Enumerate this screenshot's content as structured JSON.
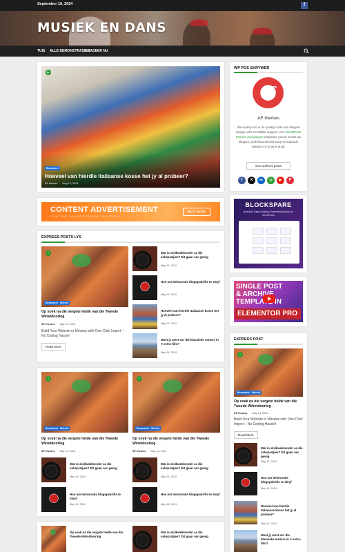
{
  "topbar": {
    "date": "September 16, 2024",
    "social_icon": "facebook-icon"
  },
  "site": {
    "title": "MUSIEK EN DANS"
  },
  "nav": {
    "items": [
      "TUIS",
      "ALLE DEMONSTRASIES",
      "GRADEER NU"
    ],
    "search_icon": "search-icon"
  },
  "hero": {
    "category": "Beoordeel",
    "title": "Hoeveel van hierdie Italiaanse kosse het jy al probeer?",
    "author": "AF themes",
    "date": "May 14, 2024"
  },
  "ad": {
    "title": "CONTENT ADVERTISEMENT",
    "subtitle": "CONTENT ADVERTISEMENT SECTION",
    "button": "BUY NOW"
  },
  "express_list": {
    "title": "EXPRESS POSTS LYS",
    "main": {
      "categories": [
        "Beoordeel",
        "Wêreld"
      ],
      "title": "Op soek na die vergete helde van die Tweede Wêreldoorlog",
      "author": "AF themes",
      "date": "May 14, 2024",
      "excerpt": "Build Your Website in Minutes with One-Click Import – No Coding Hassle!",
      "read_more": "Read More"
    },
    "side": [
      {
        "title": "Wat is skrikwekkender as die sokspratjies? Dit gaan oor gewig",
        "date": "May 14, 2024"
      },
      {
        "title": "Hoe om bekroonde blogopskrifte te skryf",
        "date": "May 14, 2024"
      },
      {
        "title": "Hoeveel van hierdie Italiaanse kosse het jy al probeer?",
        "date": "May 14, 2024"
      },
      {
        "title": "Moet jy weet oor die klassieke motors in 'n retro-film?",
        "date": "May 14, 2024"
      }
    ]
  },
  "grid_section": {
    "cols": [
      {
        "categories": [
          "Beoordeel",
          "Wêreld"
        ],
        "title": "Op soek na die vergete helde van die Tweede Wêreldoorlog",
        "author": "AF themes",
        "date": "May 14, 2024",
        "small": [
          {
            "title": "Wat is skrikwekkender as die sokspratjies? Dit gaan oor gewig",
            "date": "May 14, 2024"
          },
          {
            "title": "Hoe om bekroonde blogopskrifte te skryf",
            "date": "May 14, 2024"
          }
        ]
      },
      {
        "categories": [
          "Beoordeel",
          "Wêreld"
        ],
        "title": "Op soek na die vergete helde van die Tweede Wêreldoorlog",
        "author": "AF themes",
        "date": "May 14, 2024",
        "small": [
          {
            "title": "Wat is skrikwekkender as die sokspratjies? Dit gaan oor gewig",
            "date": "May 14, 2024"
          },
          {
            "title": "Hoe om bekroonde blogopskrifte te skryf",
            "date": "May 14, 2024"
          }
        ]
      }
    ]
  },
  "bottom_row": [
    {
      "title": "Op soek na die vergete helde van die Tweede Wêreldoorlog"
    },
    {
      "title": "Wat is skrikwekkender as die sokspratjies? Dit gaan oor gewig"
    }
  ],
  "author_widget": {
    "title": "WP POS SKRYWER",
    "name": "AF themes",
    "bio_1": "We mainly focus on quality code and elegant design with incredible support. Our ",
    "bio_link": "WordPress themes and plugins",
    "bio_2": " empower you to create an elegant, professional and easy-to-maintain website in no time at all.",
    "button": "See author's posts",
    "social": [
      "facebook-icon",
      "x-icon",
      "linkedin-icon",
      "instagram-icon",
      "youtube-icon",
      "pinterest-icon"
    ]
  },
  "blockspare": {
    "title": "BLOCKSPARE",
    "subtitle": "Beautiful Page Building Gutenberg Blocks for WordPress"
  },
  "elementor": {
    "line1": "SINGLE POST",
    "line2": "& ARCHIVE",
    "line3": "TEMPLATE IN",
    "line4": "ELEMENTOR PRO"
  },
  "express_post": {
    "title": "EXPRESS POST",
    "main": {
      "categories": [
        "Beoordeel",
        "Wêreld"
      ],
      "title": "Op soek na die vergete helde van die Tweede Wêreldoorlog",
      "author": "AF themes",
      "date": "May 14, 2024",
      "excerpt": "Build Your Website in Minutes with One-Click Import – No Coding Hassle!",
      "read_more": "Read More"
    },
    "side": [
      {
        "title": "Wat is skrikwekkender as die sokspratjies? Dit gaan oor gewig",
        "date": "May 14, 2024"
      },
      {
        "title": "Hoe om bekroonde blogopskrifte te skryf",
        "date": "May 14, 2024"
      },
      {
        "title": "Hoeveel van hierdie Italiaanse kosse het jy al probeer?",
        "date": "May 14, 2024"
      },
      {
        "title": "Moet jy weet oor die klassieke motors in 'n retro-film?",
        "date": "May 14, 2024"
      }
    ]
  },
  "colors": {
    "accent": "#2c9a2f",
    "topbar": "#1d1d1d",
    "badge_blue": "#1e6fd9"
  }
}
